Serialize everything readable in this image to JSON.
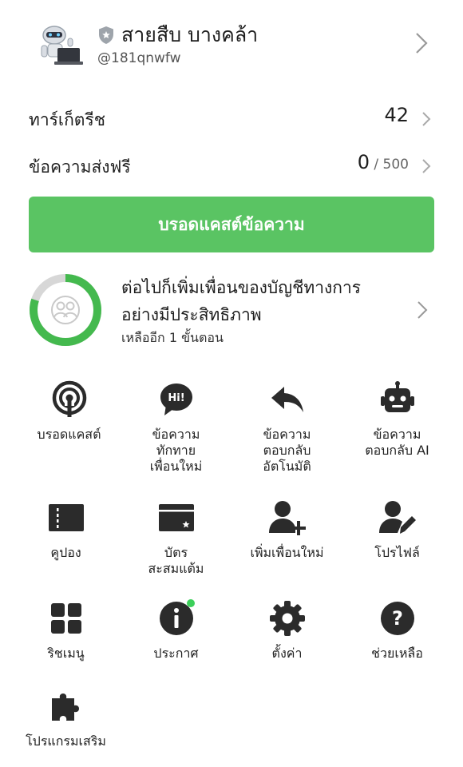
{
  "profile": {
    "name": "สายสืบ บางคล้า",
    "handle": "@181qnwfw"
  },
  "stats": [
    {
      "label": "ทาร์เก็ตรีช",
      "value": "42",
      "sub": ""
    },
    {
      "label": "ข้อความส่งฟรี",
      "value": "0",
      "sub": " / 500"
    }
  ],
  "broadcast_button": "บรอดแคสต์ข้อความ",
  "steps": {
    "line1": "ต่อไปก็เพิ่มเพื่อนของบัญชีทางการ",
    "line2": "อย่างมีประสิทธิภาพ",
    "remaining": "เหลืออีก 1 ขั้นตอน",
    "progress_fraction": 0.8
  },
  "menu": [
    {
      "label": "บรอดแคสต์",
      "icon": "broadcast-icon"
    },
    {
      "label": "ข้อความ\nทักทาย\nเพื่อนใหม่",
      "icon": "greeting-icon"
    },
    {
      "label": "ข้อความ\nตอบกลับ\nอัตโนมัติ",
      "icon": "reply-icon"
    },
    {
      "label": "ข้อความ\nตอบกลับ AI",
      "icon": "robot-icon"
    },
    {
      "label": "คูปอง",
      "icon": "coupon-icon"
    },
    {
      "label": "บัตร\nสะสมแต้ม",
      "icon": "reward-card-icon"
    },
    {
      "label": "เพิ่มเพื่อนใหม่",
      "icon": "add-friend-icon"
    },
    {
      "label": "โปรไฟล์",
      "icon": "profile-edit-icon"
    },
    {
      "label": "ริชเมนู",
      "icon": "rich-menu-icon"
    },
    {
      "label": "ประกาศ",
      "icon": "announcement-icon"
    },
    {
      "label": "ตั้งค่า",
      "icon": "settings-gear-icon"
    },
    {
      "label": "ช่วยเหลือ",
      "icon": "help-icon"
    },
    {
      "label": "โปรแกรมเสริม",
      "icon": "plugin-icon"
    }
  ],
  "colors": {
    "accent_green": "#5ac463",
    "icon_dark": "#2b2b2b",
    "notification_dot": "#3ccf5a"
  }
}
